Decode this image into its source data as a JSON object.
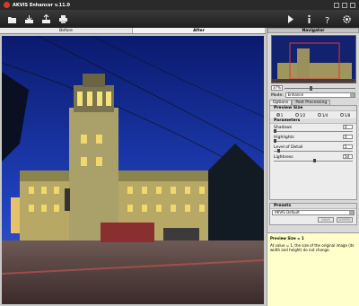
{
  "window": {
    "title": "AKVIS Enhancer v.11.0"
  },
  "toolbar": {
    "left_icons": [
      "open-icon",
      "save-icon",
      "share-icon",
      "print-icon"
    ],
    "right_icons": [
      "run-icon",
      "info-icon",
      "help-icon",
      "settings-icon"
    ]
  },
  "view_tabs": {
    "before": "Before",
    "after": "After"
  },
  "navigator": {
    "title": "Navigator",
    "zoom": "37%"
  },
  "mode": {
    "label": "Mode:",
    "value": "Enhance"
  },
  "settings_tabs": {
    "options": "Options",
    "post_processing": "Post Processing"
  },
  "preview_size": {
    "title": "Preview Size",
    "options": [
      "1",
      "1/2",
      "1/4",
      "1/8"
    ],
    "selected": "1"
  },
  "parameters": {
    "title": "Parameters",
    "items": [
      {
        "label": "Shadows",
        "value": "0",
        "level": 0.0
      },
      {
        "label": "Highlights",
        "value": "0",
        "level": 0.0
      },
      {
        "label": "Level of Detail",
        "value": "5",
        "level": 0.05
      },
      {
        "label": "Lightness",
        "value": "50",
        "level": 0.5
      }
    ]
  },
  "presets": {
    "title": "Presets",
    "value": "AKVIS Default",
    "buttons": [
      "Save",
      "Delete"
    ]
  },
  "help": {
    "title": "Preview Size = 1",
    "text": "At value = 1, the size of the original image (its width and height) do not change."
  },
  "colors": {
    "accent": "#2a2a2a",
    "help_bg": "#ffffcc"
  }
}
